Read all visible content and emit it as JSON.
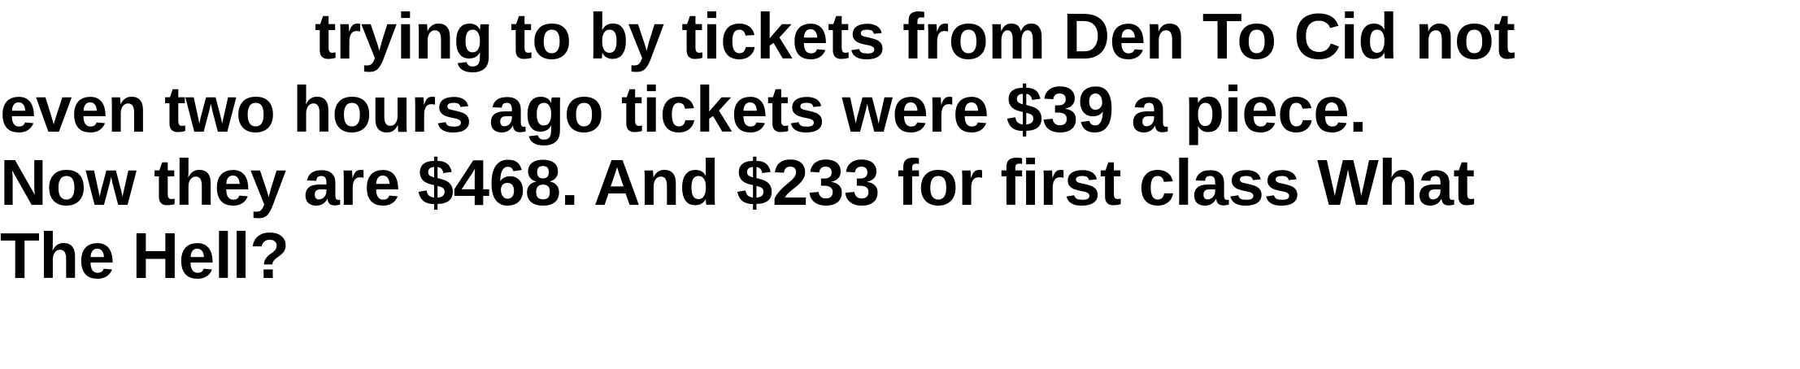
{
  "post": {
    "lines": [
      "trying to by tickets from Den To Cid not",
      "even two hours ago tickets were $39 a piece.",
      "Now they are $468. And $233 for first class What",
      "The Hell?"
    ]
  },
  "colors": {
    "background": "#ffffff",
    "text": "#000000"
  }
}
